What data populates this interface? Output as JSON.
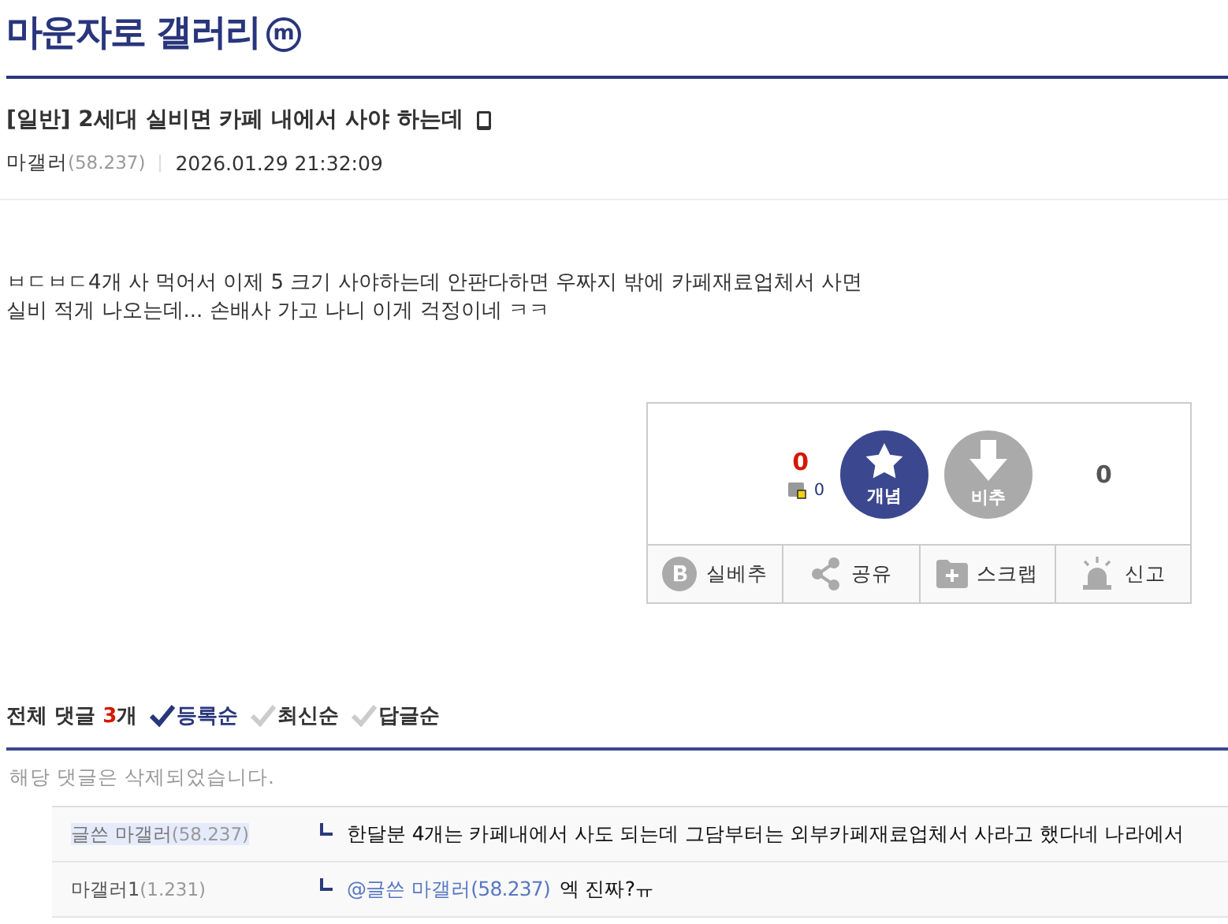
{
  "gallery": {
    "title": "마운자로 갤러리",
    "badge": "m"
  },
  "post": {
    "head": "[일반]",
    "title": "2세대 실비면 카페 내에서 사야 하는데",
    "mobile": true,
    "author": "마갤러",
    "ip": "(58.237)",
    "date": "2026.01.29 21:32:09",
    "body": [
      "ㅂㄷㅂㄷ4개 사 먹어서 이제 5 크기 사야하는데 안판다하면 우짜지 밖에 카페재료업체서 사면",
      "실비 적게 나오는데... 손배사 가고 나니 이게 걱정이네 ㅋㅋ"
    ]
  },
  "recommend": {
    "up_count": "0",
    "fixed_count": "0",
    "up_label": "개념",
    "down_label": "비추",
    "down_count": "0"
  },
  "actions": [
    {
      "kind": "best",
      "label": "실베추"
    },
    {
      "kind": "share",
      "label": "공유"
    },
    {
      "kind": "scrap",
      "label": "스크랩"
    },
    {
      "kind": "report",
      "label": "신고"
    }
  ],
  "comments": {
    "label": "전체 댓글",
    "count": "3",
    "unit": "개",
    "sorts": [
      {
        "label": "등록순",
        "selected": true
      },
      {
        "label": "최신순",
        "selected": false
      },
      {
        "label": "답글순",
        "selected": false
      }
    ],
    "deleted": "해당 댓글은 삭제되었습니다.",
    "replies": [
      {
        "author": "글쓴 마갤러",
        "ip": "(58.237)",
        "is_writer": true,
        "text": "한달분 4개는 카페내에서 사도 되는데 그담부터는 외부카페재료업체서 사라고 했다네 나라에서"
      },
      {
        "author": "마갤러1",
        "ip": "(1.231)",
        "is_writer": false,
        "mention": "@글쓴 마갤러(58.237)",
        "text": "엑 진짜?ㅠ"
      }
    ]
  }
}
